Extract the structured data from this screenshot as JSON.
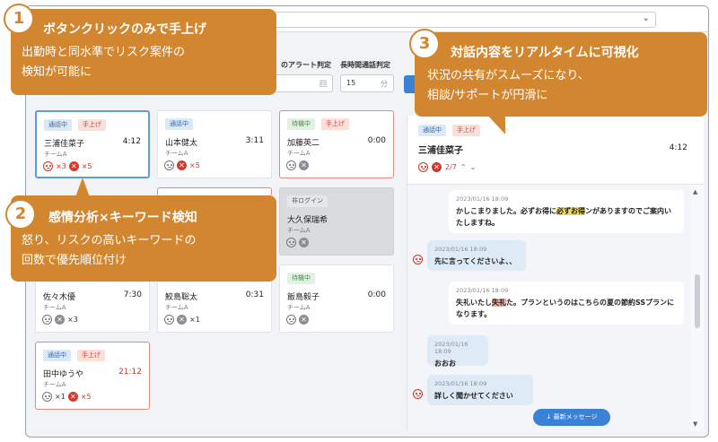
{
  "filters": {
    "alert_label": "のアラート判定",
    "alert_unit": "回",
    "long_label": "長時間通話判定",
    "long_value": "15",
    "long_unit": "分"
  },
  "cards": [
    {
      "status": "通話中",
      "up": "手上げ",
      "name": "三浦佳菜子",
      "time": "4:12",
      "team": "チームA",
      "c1": "×3",
      "c2": "×5",
      "red": true
    },
    {
      "status": "通話中",
      "up": "",
      "name": "山本健太",
      "time": "3:11",
      "team": "チームA",
      "c1": "",
      "c2": "×5",
      "red": true
    },
    {
      "status": "待機中",
      "up": "手上げ",
      "name": "加藤英二",
      "time": "0:00",
      "team": "チームA",
      "c1": "",
      "c2": "",
      "red": false
    },
    {
      "status": "非ログイン",
      "up": "",
      "name": "大久保瑞希",
      "time": "",
      "team": "チームA",
      "c1": "",
      "c2": "",
      "red": false
    },
    {
      "status": "",
      "up": "",
      "name": "佐々木優",
      "time": "7:30",
      "team": "チームA",
      "c1": "",
      "c2": "×3",
      "red": false
    },
    {
      "status": "",
      "up": "",
      "name": "鮫島聡太",
      "time": "0:31",
      "team": "チームA",
      "c1": "",
      "c2": "×1",
      "red": false
    },
    {
      "status": "待機中",
      "up": "",
      "name": "飯島毅子",
      "time": "0:00",
      "team": "チームA",
      "c1": "",
      "c2": "",
      "red": false
    },
    {
      "status": "通話中",
      "up": "手上げ",
      "name": "田中ゆうや",
      "time": "21:12",
      "team": "チームA",
      "c1": "×1",
      "c2": "×5",
      "red": true
    }
  ],
  "detail": {
    "status": "通話中",
    "up": "手上げ",
    "name": "三浦佳菜子",
    "time": "4:12",
    "count": "2/7"
  },
  "messages": [
    {
      "ts": "2023/01/16 18:09",
      "pre": "かしこまりました。必ずお得に",
      "hl": "必ずお得",
      "post": "ンがありますのでご案内いたしますね。"
    },
    {
      "ts": "2023/01/16 18:09",
      "text": "先に言ってくださいよ、、"
    },
    {
      "ts": "2023/01/16 18:09",
      "pre": "失礼いたし",
      "hl": "失礼",
      "post": "た。プランというのはこちらの夏の節約SSプランになります。"
    },
    {
      "ts": "2023/01/16 18:09",
      "text": "おおお"
    },
    {
      "ts": "2023/01/16 18:09",
      "text": "詳しく聞かせてください"
    }
  ],
  "latest_button": "最新メッセージ",
  "callouts": [
    {
      "num": "1",
      "head": "ボタンクリックのみで手上げ",
      "body1": "出勤時と同水準でリスク案件の",
      "body2": "検知が可能に"
    },
    {
      "num": "2",
      "head": "感情分析×キーワード検知",
      "body1": "怒り、リスクの高いキーワードの",
      "body2": "回数で優先順位付け"
    },
    {
      "num": "3",
      "head": "対話内容をリアルタイムに可視化",
      "body1": "状況の共有がスムーズになり、",
      "body2": "相談/サポートが円滑に"
    }
  ]
}
